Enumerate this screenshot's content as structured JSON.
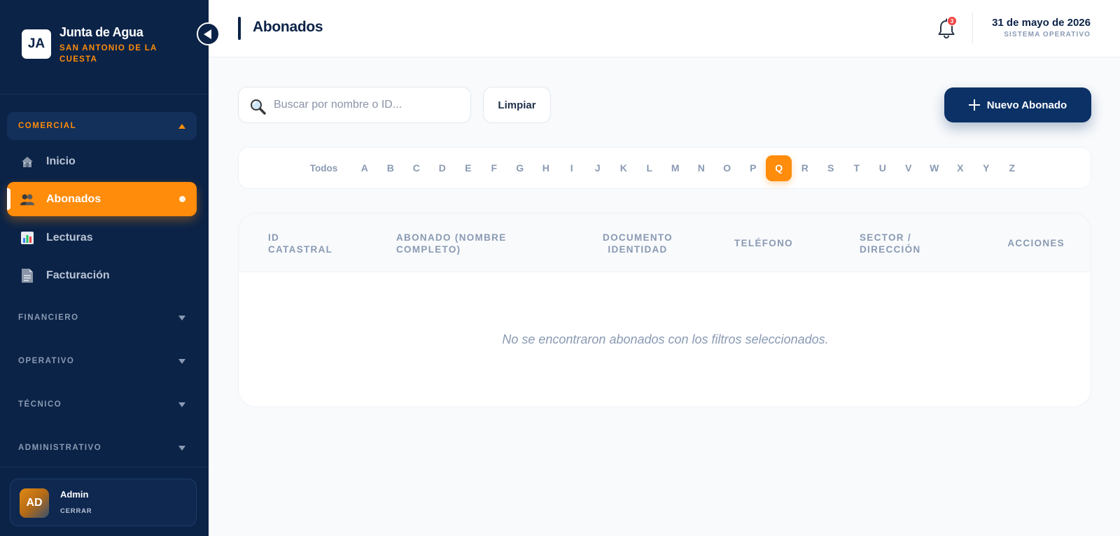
{
  "brand": {
    "logo": "JA",
    "name": "Junta de Agua",
    "subtitle": "SAN ANTONIO DE LA CUESTA"
  },
  "sidebar": {
    "sections": [
      {
        "label": "COMERCIAL",
        "expanded": true
      },
      {
        "label": "FINANCIERO",
        "expanded": false
      },
      {
        "label": "OPERATIVO",
        "expanded": false
      },
      {
        "label": "TÉCNICO",
        "expanded": false
      },
      {
        "label": "ADMINISTRATIVO",
        "expanded": false
      }
    ],
    "items": [
      {
        "label": "Inicio",
        "icon": "home-icon"
      },
      {
        "label": "Abonados",
        "icon": "users-icon",
        "active": true
      },
      {
        "label": "Lecturas",
        "icon": "chart-icon"
      },
      {
        "label": "Facturación",
        "icon": "document-icon"
      }
    ]
  },
  "user": {
    "initials": "AD",
    "name": "Admin",
    "logout_label": "CERRAR"
  },
  "header": {
    "title": "Abonados",
    "notification_count": "3",
    "date": "31 de mayo de 2026",
    "status": "SISTEMA OPERATIVO"
  },
  "toolbar": {
    "search_placeholder": "Buscar por nombre o ID...",
    "search_value": "",
    "clear_label": "Limpiar",
    "new_label": "Nuevo Abonado"
  },
  "alphabet": {
    "all_label": "Todos",
    "letters": [
      "A",
      "B",
      "C",
      "D",
      "E",
      "F",
      "G",
      "H",
      "I",
      "J",
      "K",
      "L",
      "M",
      "N",
      "O",
      "P",
      "Q",
      "R",
      "S",
      "T",
      "U",
      "V",
      "W",
      "X",
      "Y",
      "Z"
    ],
    "selected": "Q"
  },
  "table": {
    "columns": [
      "ID\nCATASTRAL",
      "ABONADO (NOMBRE\nCOMPLETO)",
      "DOCUMENTO\nIDENTIDAD",
      "TELÉFONO",
      "SECTOR /\nDIRECCIÓN",
      "ACCIONES"
    ],
    "rows": [],
    "empty_message": "No se encontraron abonados con los filtros seleccionados."
  },
  "colors": {
    "sidebar_bg": "#0b2347",
    "accent": "#ff8c0a",
    "primary_button": "#0b3166",
    "badge": "#ef4444"
  }
}
